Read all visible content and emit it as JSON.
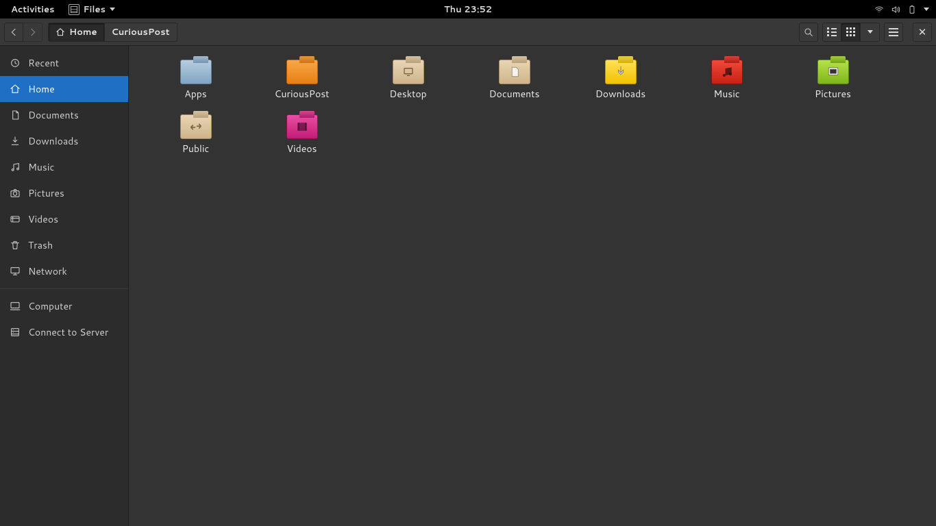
{
  "panel": {
    "activities": "Activities",
    "app_name": "Files",
    "clock": "Thu 23:52"
  },
  "toolbar": {
    "path": [
      {
        "label": "Home",
        "icon": "home-icon",
        "active": true
      },
      {
        "label": "CuriousPost",
        "active": false
      }
    ]
  },
  "sidebar": {
    "groups": [
      [
        {
          "label": "Recent",
          "icon": "clock",
          "selected": false
        },
        {
          "label": "Home",
          "icon": "home",
          "selected": true
        },
        {
          "label": "Documents",
          "icon": "doc",
          "selected": false
        },
        {
          "label": "Downloads",
          "icon": "download",
          "selected": false
        },
        {
          "label": "Music",
          "icon": "music",
          "selected": false
        },
        {
          "label": "Pictures",
          "icon": "camera",
          "selected": false
        },
        {
          "label": "Videos",
          "icon": "video",
          "selected": false
        },
        {
          "label": "Trash",
          "icon": "trash",
          "selected": false
        },
        {
          "label": "Network",
          "icon": "network",
          "selected": false
        }
      ],
      [
        {
          "label": "Computer",
          "icon": "computer",
          "selected": false
        },
        {
          "label": "Connect to Server",
          "icon": "server",
          "selected": false
        }
      ]
    ]
  },
  "files": [
    {
      "label": "Apps",
      "color": "blue",
      "emblem": ""
    },
    {
      "label": "CuriousPost",
      "color": "orange",
      "emblem": ""
    },
    {
      "label": "Desktop",
      "color": "beige",
      "emblem": "desktop"
    },
    {
      "label": "Documents",
      "color": "beige",
      "emblem": "doc"
    },
    {
      "label": "Downloads",
      "color": "yellow",
      "emblem": "dl"
    },
    {
      "label": "Music",
      "color": "red",
      "emblem": "music"
    },
    {
      "label": "Pictures",
      "color": "green",
      "emblem": "pic"
    },
    {
      "label": "Public",
      "color": "beige",
      "emblem": "public"
    },
    {
      "label": "Videos",
      "color": "pink",
      "emblem": "video"
    }
  ]
}
